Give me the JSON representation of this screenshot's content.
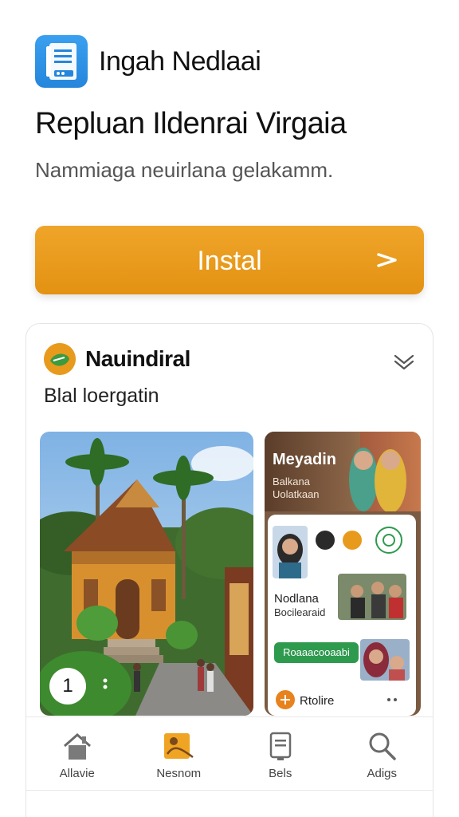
{
  "app": {
    "name": "Ingah Nedlaai",
    "icon": "document-list-icon",
    "icon_color": "#2b8fe3"
  },
  "headline": "Repluan Ildenrai Virgaia",
  "subline": "Nammiaga neuirlana gelakamm.",
  "install": {
    "label": "Instal",
    "color": "#e99a1f",
    "icon": "chevron-right-icon"
  },
  "card": {
    "title": "Nauindiral",
    "subtitle": "Blal loergatin",
    "logo": "globe-leaf-icon",
    "expand_icon": "chevron-down-icon",
    "photo": {
      "badge": "1",
      "alt_icon": "scenic-temple-photo"
    },
    "side": {
      "title": "Meyadin",
      "subtitle": "Balkana Uolatkaan",
      "label_1": "Nodlana",
      "label_2": "Bocilearaid",
      "chip": "Roaaacooaabi",
      "bottom": "Rtolire"
    }
  },
  "nav": [
    {
      "label": "Allavie",
      "icon": "home-icon"
    },
    {
      "label": "Nesnom",
      "icon": "gallery-icon",
      "active": true
    },
    {
      "label": "Bels",
      "icon": "document-icon"
    },
    {
      "label": "Adigs",
      "icon": "search-icon"
    }
  ]
}
